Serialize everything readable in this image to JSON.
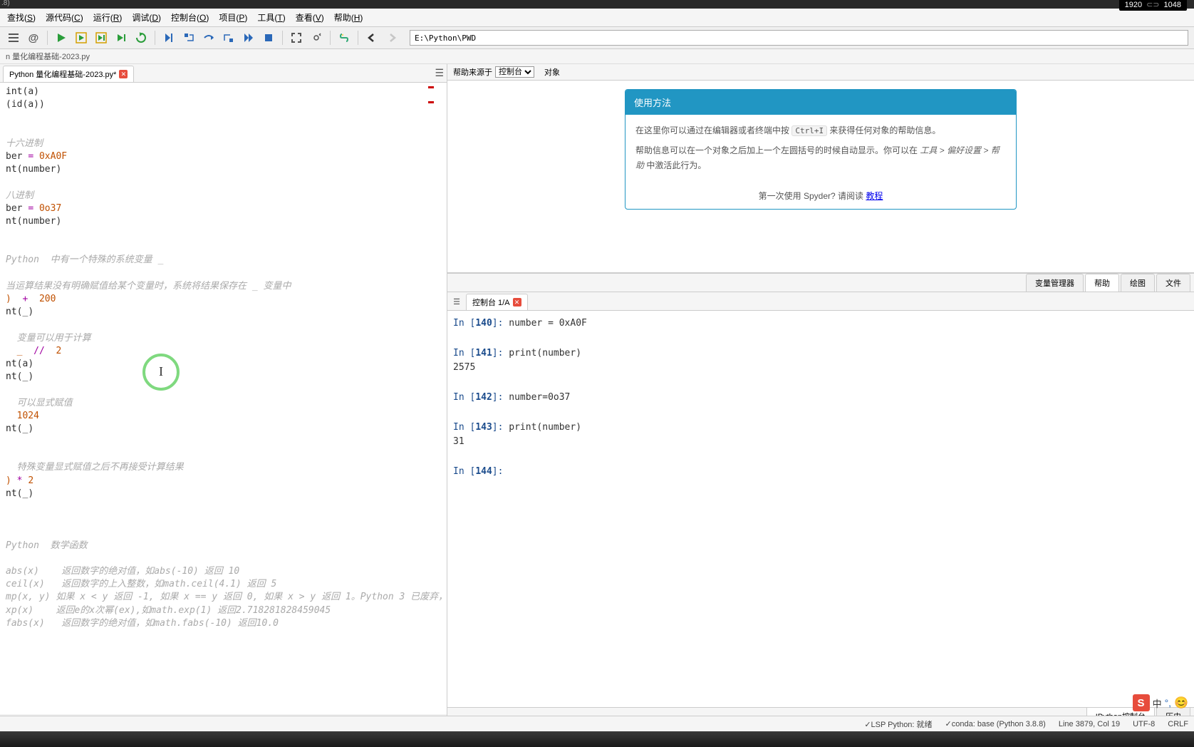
{
  "topbar": {
    "resolution": "1920",
    "resolution2": "1048"
  },
  "menubar": {
    "items": [
      {
        "label": "查找(S)",
        "key": "S"
      },
      {
        "label": "源代码(C)",
        "key": "C"
      },
      {
        "label": "运行(R)",
        "key": "R"
      },
      {
        "label": "调试(D)",
        "key": "D"
      },
      {
        "label": "控制台(O)",
        "key": "O"
      },
      {
        "label": "项目(P)",
        "key": "P"
      },
      {
        "label": "工具(T)",
        "key": "T"
      },
      {
        "label": "查看(V)",
        "key": "V"
      },
      {
        "label": "帮助(H)",
        "key": "H"
      }
    ]
  },
  "toolbar": {
    "path": "E:\\Python\\PWD"
  },
  "breadcrumb": "n 量化编程基础-2023.py",
  "editor": {
    "tab_label": "Python 量化编程基础-2023.py*",
    "lines": [
      {
        "t": "code",
        "c": "int(a)"
      },
      {
        "t": "code",
        "c": "(id(a))"
      },
      {
        "t": "blank"
      },
      {
        "t": "blank"
      },
      {
        "t": "comment",
        "c": "十六进制"
      },
      {
        "t": "assign",
        "c": "ber = 0xA0F"
      },
      {
        "t": "code",
        "c": "nt(number)"
      },
      {
        "t": "blank"
      },
      {
        "t": "comment",
        "c": "八进制"
      },
      {
        "t": "assign",
        "c": "ber=0o37"
      },
      {
        "t": "code",
        "c": "nt(number)"
      },
      {
        "t": "blank"
      },
      {
        "t": "blank"
      },
      {
        "t": "comment",
        "c": "Python  中有一个特殊的系统变量 _"
      },
      {
        "t": "blank"
      },
      {
        "t": "comment",
        "c": "当运算结果没有明确赋值给某个变量时，系统将结果保存在 _ 变量中"
      },
      {
        "t": "expr",
        "c": ") + 200"
      },
      {
        "t": "code",
        "c": "nt(_)"
      },
      {
        "t": "blank"
      },
      {
        "t": "comment",
        "c": "  变量可以用于计算"
      },
      {
        "t": "expr",
        "c": "  _ // 2"
      },
      {
        "t": "code",
        "c": "nt(a)"
      },
      {
        "t": "code",
        "c": "nt(_)"
      },
      {
        "t": "blank"
      },
      {
        "t": "comment",
        "c": "  可以显式赋值"
      },
      {
        "t": "expr",
        "c": "  1024"
      },
      {
        "t": "code",
        "c": "nt(_)"
      },
      {
        "t": "blank"
      },
      {
        "t": "blank"
      },
      {
        "t": "comment",
        "c": "  特殊变量显式赋值之后不再接受计算结果"
      },
      {
        "t": "expr",
        "c": ")*2"
      },
      {
        "t": "code",
        "c": "nt(_)"
      },
      {
        "t": "blank"
      },
      {
        "t": "blank"
      },
      {
        "t": "blank"
      },
      {
        "t": "comment",
        "c": "Python  数学函数"
      },
      {
        "t": "blank"
      },
      {
        "t": "comment",
        "c": "abs(x)    返回数字的绝对值，如abs(-10) 返回 10"
      },
      {
        "t": "comment",
        "c": "ceil(x)   返回数字的上入整数，如math.ceil(4.1) 返回 5"
      },
      {
        "t": "comment",
        "c": "mp(x, y) 如果 x < y 返回 -1, 如果 x == y 返回 0, 如果 x > y 返回 1。Python 3 已废弃，"
      },
      {
        "t": "comment",
        "c": "xp(x)    返回e的x次幂(ex),如math.exp(1) 返回2.718281828459045"
      },
      {
        "t": "comment",
        "c": "fabs(x)   返回数字的绝对值，如math.fabs(-10) 返回10.0"
      }
    ]
  },
  "help": {
    "source_label": "帮助来源于",
    "source_select": "控制台",
    "object_label": "对象",
    "title": "使用方法",
    "body1_pre": "在这里你可以通过在编辑器或者终端中按 ",
    "body1_key": "Ctrl+I",
    "body1_post": " 来获得任何对象的帮助信息。",
    "body2": "帮助信息可以在一个对象之后加上一个左圆括号的时候自动显示。你可以在 工具 > 偏好设置 > 帮助 中激活此行为。",
    "footer_pre": "第一次使用 Spyder? 请阅读 ",
    "footer_link": "教程"
  },
  "right_tabs": [
    "变量管理器",
    "帮助",
    "绘图",
    "文件"
  ],
  "console": {
    "tab_label": "控制台 1/A",
    "lines": [
      {
        "n": "140",
        "c": "number = 0xA0F"
      },
      {
        "blank": true
      },
      {
        "n": "141",
        "c": "print(number)"
      },
      {
        "out": "2575"
      },
      {
        "blank": true
      },
      {
        "n": "142",
        "c": "number=0o37"
      },
      {
        "blank": true
      },
      {
        "n": "143",
        "c": "print(number)"
      },
      {
        "out": "31"
      },
      {
        "blank": true
      },
      {
        "n": "144",
        "c": ""
      }
    ]
  },
  "bottom_tabs": [
    "IPython控制台",
    "历史"
  ],
  "statusbar": {
    "lsp": "✓LSP Python: 就绪",
    "conda": "✓conda: base (Python 3.8.8)",
    "pos": "Line 3879, Col 19",
    "enc": "UTF-8",
    "eol": "CRLF"
  },
  "ime": {
    "badge": "S",
    "lang": "中"
  }
}
